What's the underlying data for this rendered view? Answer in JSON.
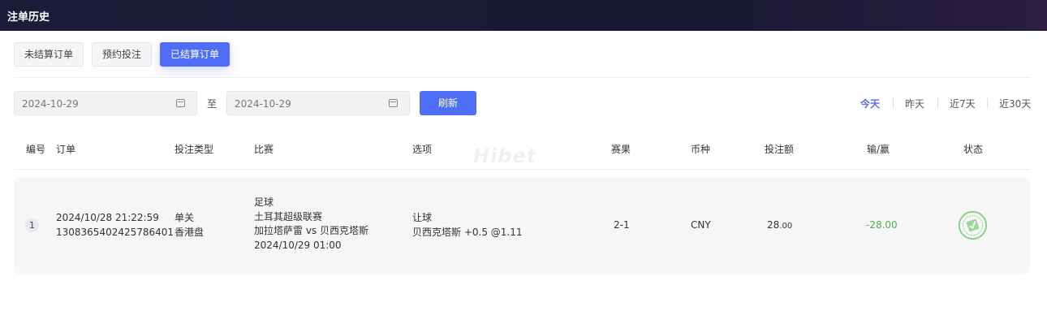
{
  "header": {
    "title": "注单历史"
  },
  "tabs": [
    "未结算订单",
    "预约投注",
    "已结算订单"
  ],
  "filters": {
    "date_from": "2024-10-29",
    "separator": "至",
    "date_to": "2024-10-29",
    "refresh_label": "刷新",
    "quick_ranges": [
      "今天",
      "昨天",
      "近7天",
      "近30天"
    ],
    "active_quick_range": "今天"
  },
  "columns": [
    "编号",
    "订单",
    "投注类型",
    "比赛",
    "选项",
    "赛果",
    "币种",
    "投注额",
    "输/赢",
    "状态"
  ],
  "rows": [
    {
      "index": "1",
      "order_time": "2024/10/28 21:22:59",
      "order_id": "1308365402425786401",
      "bet_type": "单关",
      "odds_type": "香港盘",
      "sport": "足球",
      "league": "土耳其超级联赛",
      "match": "加拉塔萨雷 vs 贝西克塔斯",
      "match_time": "2024/10/29 01:00",
      "market": "让球",
      "selection": "贝西克塔斯 +0.5 @1.11",
      "result": "2-1",
      "currency": "CNY",
      "stake_int": "28",
      "stake_dec": ".00",
      "win_loss": "-28.00",
      "status_icon": "settled-stamp-icon"
    }
  ],
  "watermark": "Hibet",
  "colors": {
    "accent": "#4f6ef7",
    "loss": "#47b34a",
    "topbar": "#1c1c3a"
  }
}
